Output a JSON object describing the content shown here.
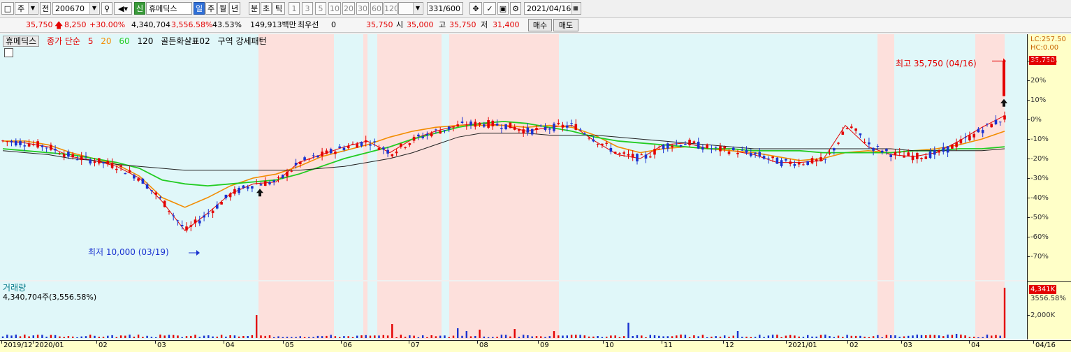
{
  "toolbar": {
    "period_type": "주",
    "prev_label": "전",
    "stock_code": "200670",
    "badge_new": "신",
    "stock_name": "휴메딕스",
    "periods": [
      "일",
      "주",
      "월",
      "년",
      "분",
      "초",
      "틱"
    ],
    "selected_period": "일",
    "intervals": [
      "1",
      "3",
      "5",
      "10",
      "20",
      "30",
      "60",
      "120"
    ],
    "count": "331/600",
    "date": "2021/04/16"
  },
  "status": {
    "price": "35,750",
    "change": "8,250",
    "change_pct": "+30.00%",
    "volume": "4,340,704",
    "volume_pct": "3,556.58%",
    "turnover": "43.53%",
    "amount": "149,913백만",
    "best_label": "최우선",
    "best_value": "0",
    "best_price": "35,750",
    "open_label": "시",
    "open": "35,000",
    "high_label": "고",
    "high": "35,750",
    "low_label": "저",
    "low": "31,400",
    "buy_label": "매수",
    "sell_label": "매도"
  },
  "legend": {
    "name": "휴메딕스",
    "ma_label": "종가 단순",
    "ma5": "5",
    "ma20": "20",
    "ma60": "60",
    "ma120": "120",
    "signal": "골든화살표02",
    "zone": "구역 강세패턴"
  },
  "annotations": {
    "high_text": "최고 35,750 (04/16)",
    "low_text": "최저 10,000 (03/19)"
  },
  "right_axis": {
    "lc": "LC:257.50",
    "hc": "HC:0.00",
    "current": "35,750",
    "volume_current": "4,341K",
    "volume_pct": "3556.58%",
    "volume_tick": "2,000K"
  },
  "volume_panel": {
    "title": "거래량",
    "value": "4,340,704주(3,556.58%)"
  },
  "colors": {
    "up": "#e30000",
    "down": "#1a32d0",
    "ma5": "#e30000",
    "ma20": "#f28c00",
    "ma60": "#22cc22",
    "ma120": "#222222",
    "bg_cyan": "#e0f7f9",
    "bg_pink": "#fde0dc",
    "axis_bg": "#ffffc8"
  },
  "chart_data": {
    "type": "candlestick",
    "y_axis_unit": "%",
    "y_ticks": [
      "30.00%",
      "20%",
      "10%",
      "0%",
      "-10%",
      "-20%",
      "-30%",
      "-40%",
      "-50%",
      "-60%",
      "-70%"
    ],
    "y_range": [
      -78,
      38
    ],
    "x_labels": [
      "2019/12",
      "2020/01",
      "02",
      "03",
      "04",
      "05",
      "06",
      "07",
      "08",
      "09",
      "10",
      "11",
      "12",
      "2021/01",
      "02",
      "03",
      "04",
      "04/16"
    ],
    "series": [
      {
        "name": "5",
        "values": [
          -11,
          -12,
          -14,
          -19,
          -21,
          -24,
          -30,
          -42,
          -57,
          -48,
          -38,
          -33,
          -32,
          -22,
          -18,
          -14,
          -11,
          -17,
          -10,
          -6,
          -3,
          -2,
          -3,
          -6,
          -4,
          -3,
          -11,
          -18,
          -20,
          -13,
          -12,
          -15,
          -16,
          -18,
          -22,
          -22,
          -21,
          -3,
          -14,
          -18,
          -19,
          -17,
          -11,
          -4,
          2
        ]
      },
      {
        "name": "20",
        "values": [
          -11,
          -11,
          -13,
          -17,
          -20,
          -23,
          -29,
          -40,
          -45,
          -40,
          -34,
          -30,
          -28,
          -24,
          -19,
          -16,
          -13,
          -9,
          -6,
          -4,
          -3,
          -3,
          -3,
          -4,
          -3,
          -4,
          -8,
          -14,
          -17,
          -15,
          -14,
          -15,
          -16,
          -17,
          -19,
          -21,
          -20,
          -17,
          -16,
          -17,
          -16,
          -15,
          -13,
          -10,
          -6
        ]
      },
      {
        "name": "60",
        "values": [
          -15,
          -16,
          -17,
          -18,
          -20,
          -22,
          -25,
          -31,
          -33,
          -34,
          -33,
          -32,
          -31,
          -28,
          -24,
          -20,
          -17,
          -14,
          -10,
          -7,
          -4,
          -2,
          -1,
          -2,
          -4,
          -6,
          -9,
          -11,
          -12,
          -13,
          -14,
          -15,
          -15,
          -16,
          -16,
          -16,
          -17,
          -17,
          -17,
          -17,
          -16,
          -16,
          -15,
          -15,
          -14
        ]
      },
      {
        "name": "120",
        "values": [
          -16,
          -17,
          -18,
          -20,
          -21,
          -23,
          -24,
          -25,
          -26,
          -26,
          -26,
          -26,
          -26,
          -26,
          -25,
          -24,
          -22,
          -20,
          -17,
          -13,
          -9,
          -7,
          -7,
          -7,
          -8,
          -8,
          -8,
          -9,
          -10,
          -11,
          -12,
          -13,
          -14,
          -15,
          -15,
          -15,
          -15,
          -15,
          -15,
          -15,
          -16,
          -16,
          -16,
          -16,
          -15
        ]
      }
    ],
    "high_marker": {
      "label": "최고 35,750 (04/16)"
    },
    "low_marker": {
      "label": "최저 10,000 (03/19)"
    },
    "volume_ticks": [
      "2,000K"
    ]
  }
}
